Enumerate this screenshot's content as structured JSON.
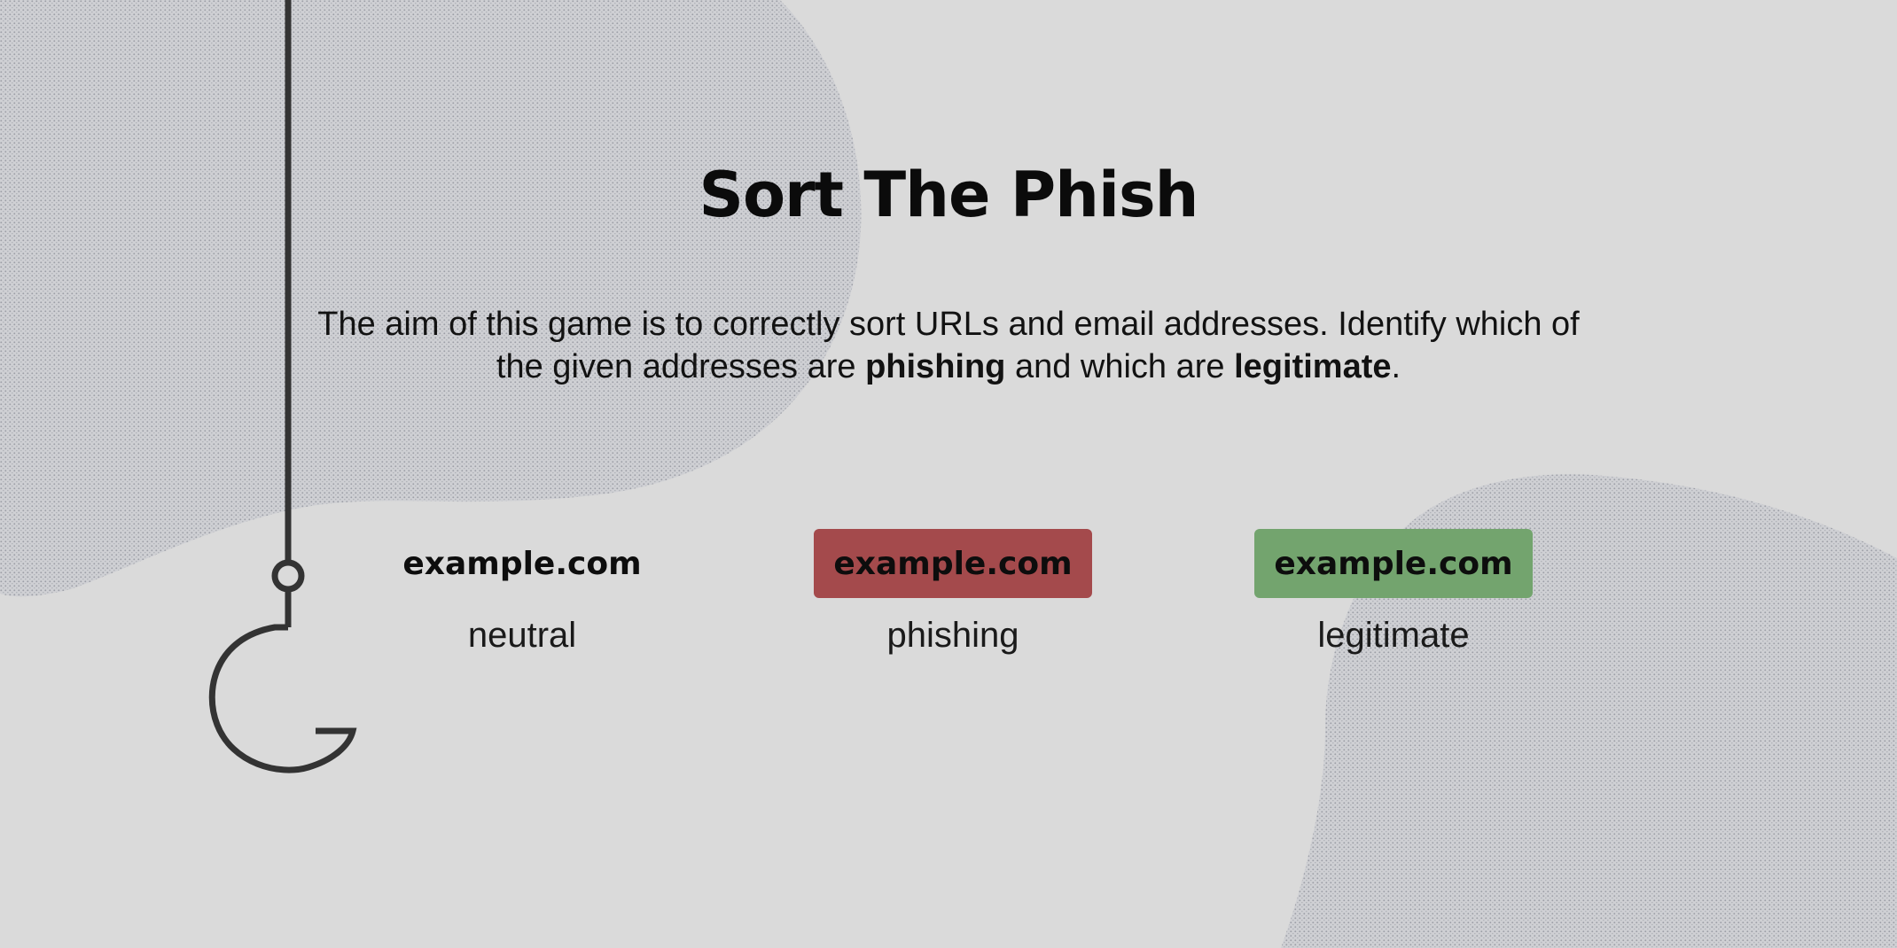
{
  "game": {
    "title": "Sort The Phish",
    "intro": {
      "text_before": "The aim of this game is to correctly sort URLs and email addresses. Identify which of the given addresses are ",
      "phishing_word": "phishing",
      "text_middle": " and which are ",
      "legitimate_word": "legitimate",
      "text_after": "."
    }
  },
  "legend": {
    "items": [
      {
        "chip_text": "example.com",
        "label": "neutral",
        "chip_color": "transparent"
      },
      {
        "chip_text": "example.com",
        "label": "phishing",
        "chip_color": "#a44a4c"
      },
      {
        "chip_text": "example.com",
        "label": "legitimate",
        "chip_color": "#73a46e"
      }
    ]
  },
  "theme": {
    "background": "#dadada",
    "blob_color": "#c6c7cc",
    "hook_color": "#333333",
    "text_color": "#111111"
  },
  "decorations": {
    "hook_icon": "fishhook-icon",
    "blob_icons": [
      "textured-blob-top-left",
      "textured-blob-bottom-right"
    ]
  }
}
